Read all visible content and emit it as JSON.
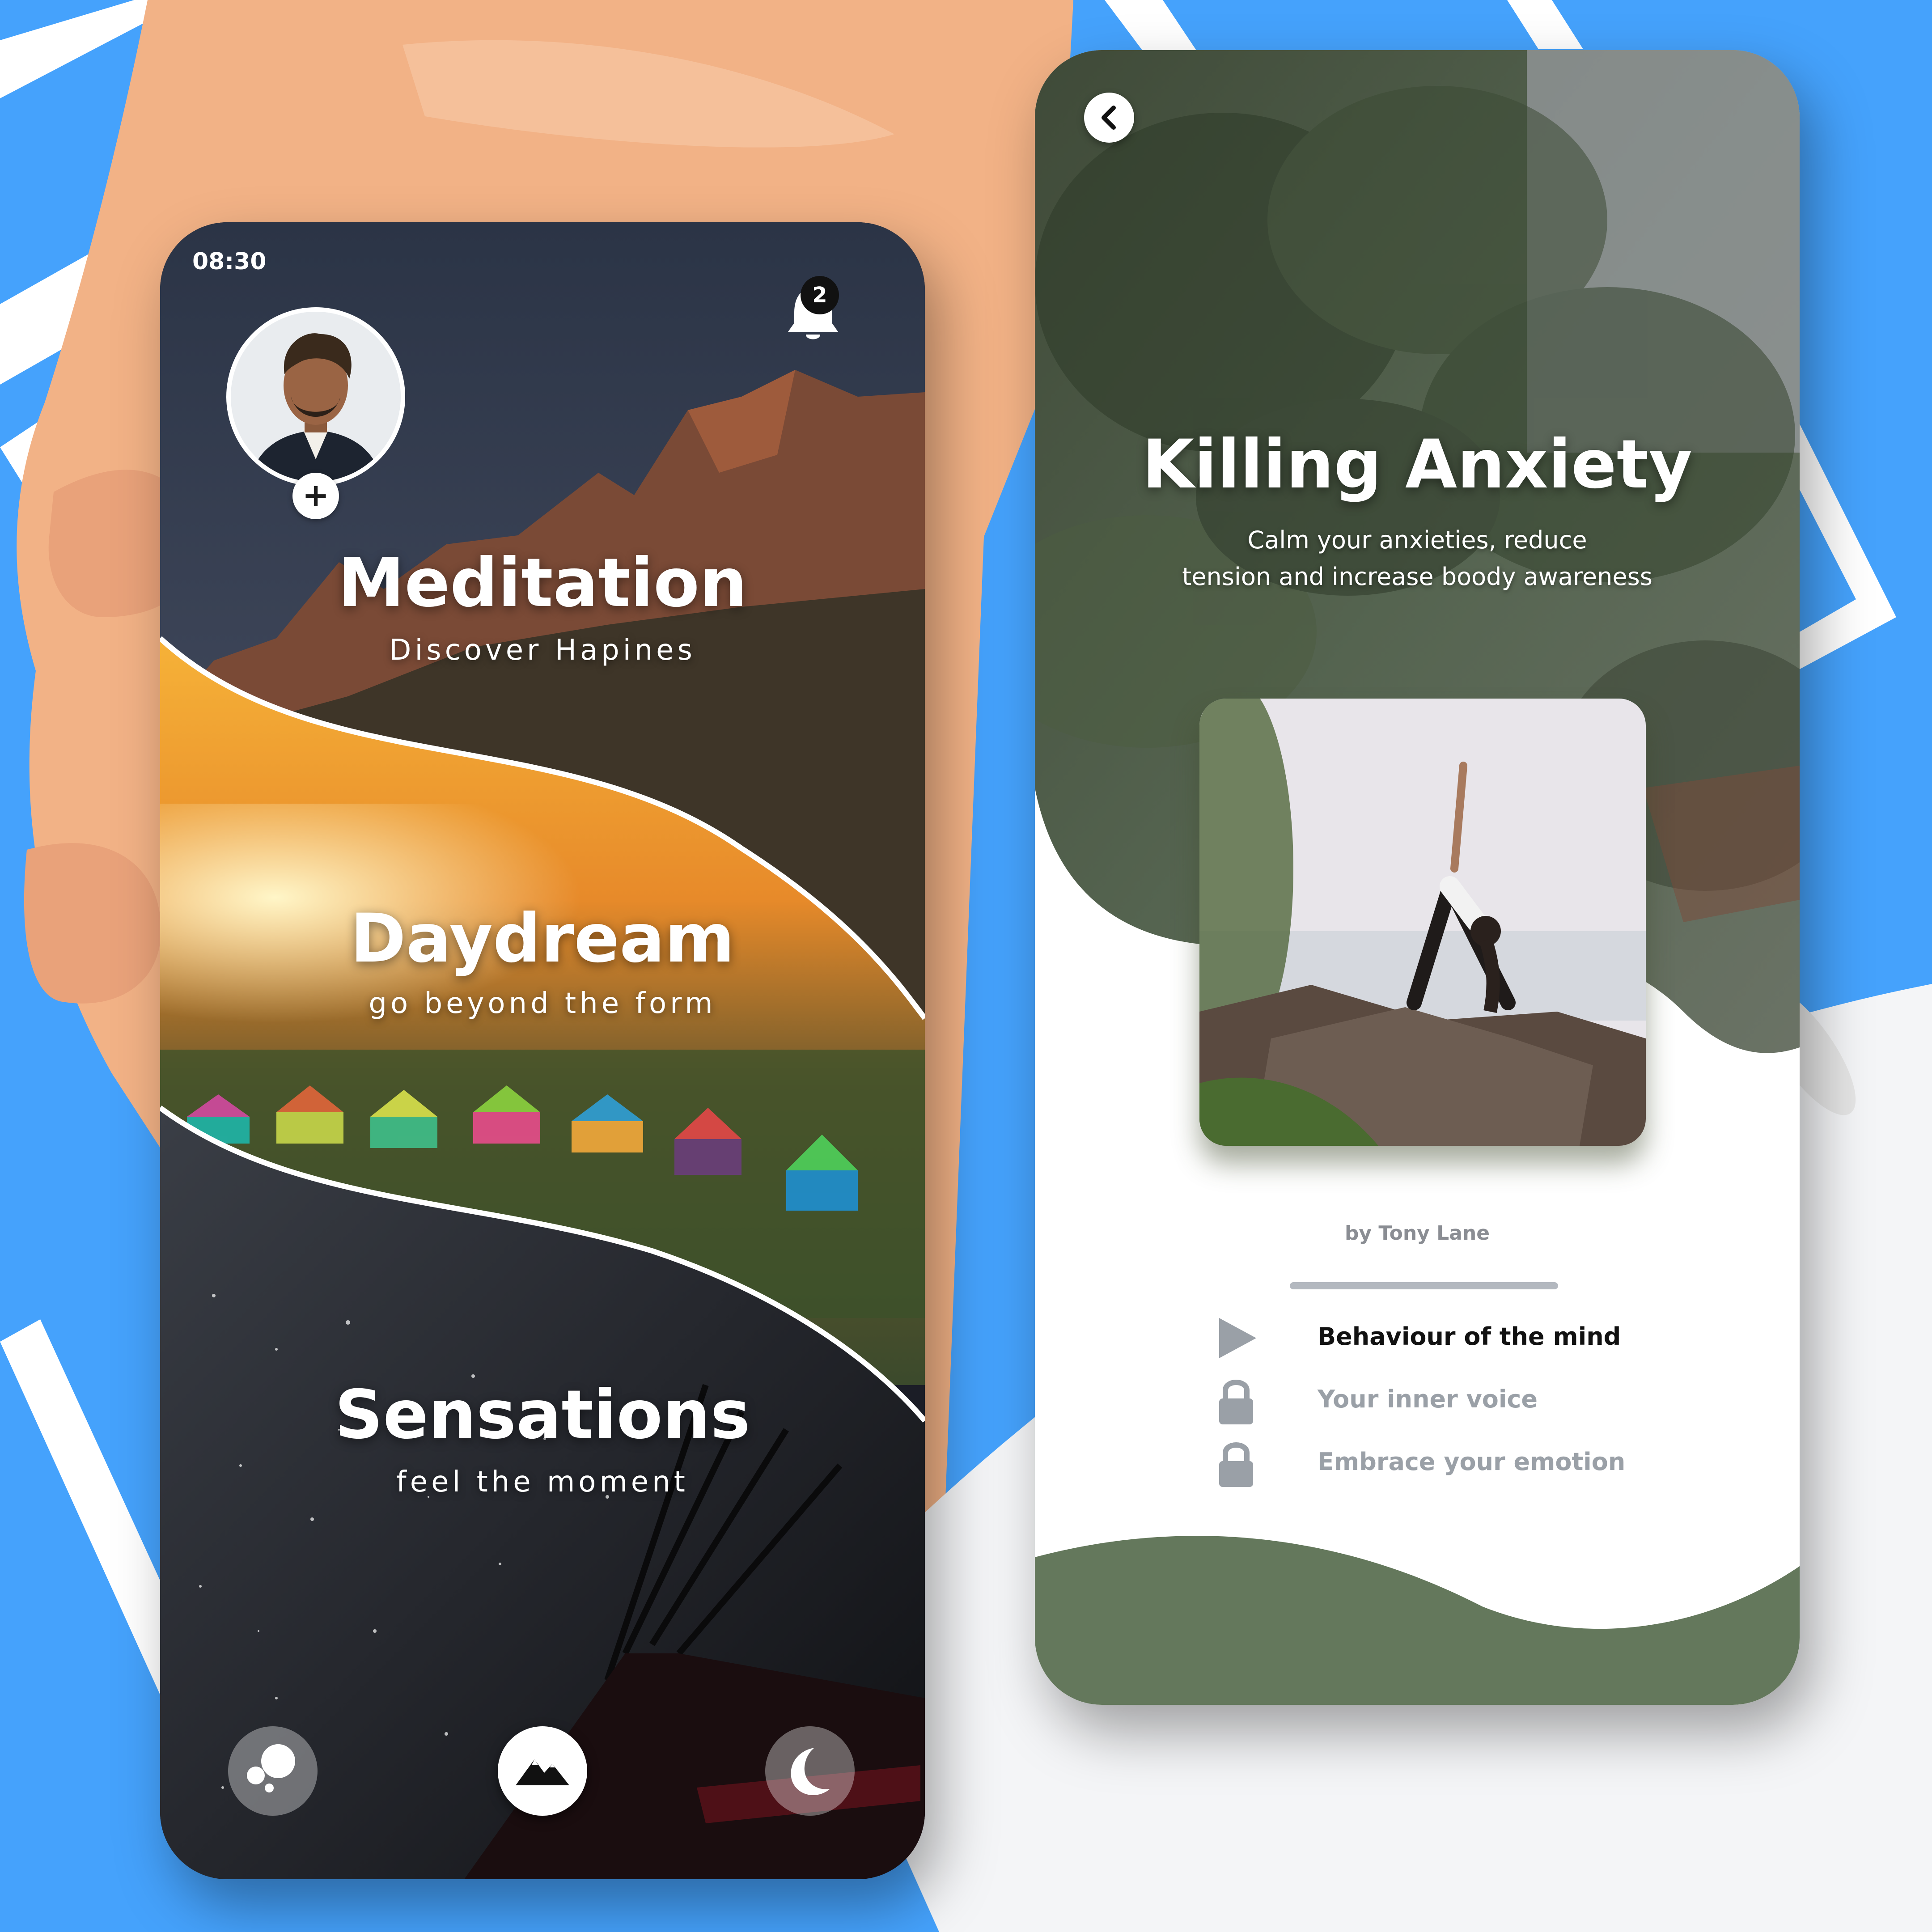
{
  "colors": {
    "background": "#45a2fc",
    "accent_green": "#64785c",
    "locked_gray": "#9aa0a7"
  },
  "home_screen": {
    "status_time": "08:30",
    "notification_count": "2",
    "icons": {
      "bell": "bell-icon",
      "avatar_add": "plus-icon"
    },
    "sections": [
      {
        "title": "Meditation",
        "subtitle": "Discover Hapines"
      },
      {
        "title": "Daydream",
        "subtitle": "go beyond the form"
      },
      {
        "title": "Sensations",
        "subtitle": "feel the moment"
      }
    ],
    "bottom_nav": [
      {
        "icon": "bubbles-icon",
        "active": false
      },
      {
        "icon": "mountains-icon",
        "active": true
      },
      {
        "icon": "moon-icon",
        "active": false
      }
    ]
  },
  "detail_screen": {
    "back_icon": "chevron-left-icon",
    "title": "Killing Anxiety",
    "description_lines": [
      "Calm your anxieties, reduce",
      "tension and increase boody awareness"
    ],
    "author": "by Tony Lane",
    "lessons": [
      {
        "label": "Behaviour of the mind",
        "icon": "play-icon",
        "locked": false
      },
      {
        "label": "Your inner voice",
        "icon": "lock-icon",
        "locked": true
      },
      {
        "label": "Embrace your emotion",
        "icon": "lock-icon",
        "locked": true
      }
    ]
  }
}
